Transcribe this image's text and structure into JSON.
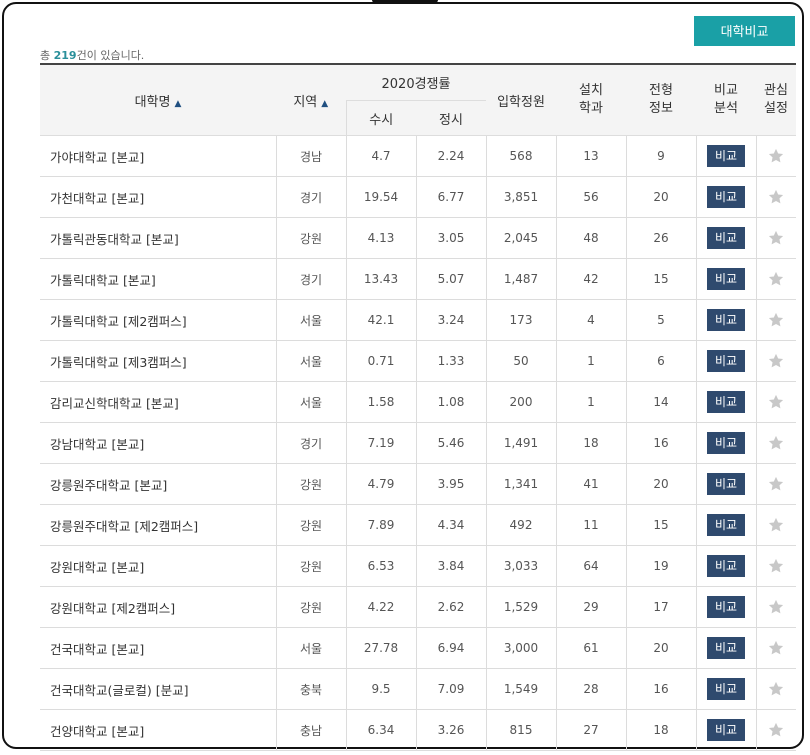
{
  "toolbar": {
    "compare_label": "대학비교"
  },
  "summary": {
    "prefix": "총 ",
    "count": "219",
    "suffix": "건이 있습니다."
  },
  "headers": {
    "name": "대학명",
    "region": "지역",
    "rate_group": "2020경쟁률",
    "susi": "수시",
    "jeongsi": "정시",
    "quota": "입학정원",
    "dept_line1": "설치",
    "dept_line2": "학과",
    "info_line1": "전형",
    "info_line2": "정보",
    "cmp_line1": "비교",
    "cmp_line2": "분석",
    "fav_line1": "관심",
    "fav_line2": "설정",
    "sort_icon": "▲"
  },
  "compare_btn": "비교",
  "colors": {
    "accent": "#1aa0a6",
    "button": "#2f4a6e",
    "count": "#2a8f9a"
  },
  "rows": [
    {
      "name": "가야대학교 [본교]",
      "region": "경남",
      "susi": "4.7",
      "jeongsi": "2.24",
      "quota": "568",
      "dept": "13",
      "info": "9"
    },
    {
      "name": "가천대학교 [본교]",
      "region": "경기",
      "susi": "19.54",
      "jeongsi": "6.77",
      "quota": "3,851",
      "dept": "56",
      "info": "20"
    },
    {
      "name": "가톨릭관동대학교 [본교]",
      "region": "강원",
      "susi": "4.13",
      "jeongsi": "3.05",
      "quota": "2,045",
      "dept": "48",
      "info": "26"
    },
    {
      "name": "가톨릭대학교 [본교]",
      "region": "경기",
      "susi": "13.43",
      "jeongsi": "5.07",
      "quota": "1,487",
      "dept": "42",
      "info": "15"
    },
    {
      "name": "가톨릭대학교 [제2캠퍼스]",
      "region": "서울",
      "susi": "42.1",
      "jeongsi": "3.24",
      "quota": "173",
      "dept": "4",
      "info": "5"
    },
    {
      "name": "가톨릭대학교 [제3캠퍼스]",
      "region": "서울",
      "susi": "0.71",
      "jeongsi": "1.33",
      "quota": "50",
      "dept": "1",
      "info": "6"
    },
    {
      "name": "감리교신학대학교 [본교]",
      "region": "서울",
      "susi": "1.58",
      "jeongsi": "1.08",
      "quota": "200",
      "dept": "1",
      "info": "14"
    },
    {
      "name": "강남대학교 [본교]",
      "region": "경기",
      "susi": "7.19",
      "jeongsi": "5.46",
      "quota": "1,491",
      "dept": "18",
      "info": "16"
    },
    {
      "name": "강릉원주대학교 [본교]",
      "region": "강원",
      "susi": "4.79",
      "jeongsi": "3.95",
      "quota": "1,341",
      "dept": "41",
      "info": "20"
    },
    {
      "name": "강릉원주대학교 [제2캠퍼스]",
      "region": "강원",
      "susi": "7.89",
      "jeongsi": "4.34",
      "quota": "492",
      "dept": "11",
      "info": "15"
    },
    {
      "name": "강원대학교 [본교]",
      "region": "강원",
      "susi": "6.53",
      "jeongsi": "3.84",
      "quota": "3,033",
      "dept": "64",
      "info": "19"
    },
    {
      "name": "강원대학교 [제2캠퍼스]",
      "region": "강원",
      "susi": "4.22",
      "jeongsi": "2.62",
      "quota": "1,529",
      "dept": "29",
      "info": "17"
    },
    {
      "name": "건국대학교 [본교]",
      "region": "서울",
      "susi": "27.78",
      "jeongsi": "6.94",
      "quota": "3,000",
      "dept": "61",
      "info": "20"
    },
    {
      "name": "건국대학교(글로컬) [분교]",
      "region": "충북",
      "susi": "9.5",
      "jeongsi": "7.09",
      "quota": "1,549",
      "dept": "28",
      "info": "16"
    },
    {
      "name": "건양대학교 [본교]",
      "region": "충남",
      "susi": "6.34",
      "jeongsi": "3.26",
      "quota": "815",
      "dept": "27",
      "info": "18"
    }
  ]
}
